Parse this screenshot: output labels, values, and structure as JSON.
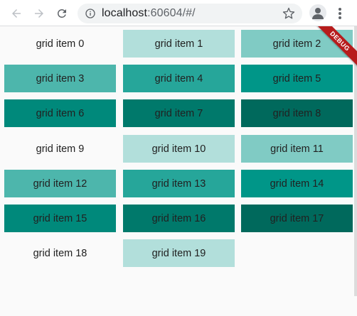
{
  "browser": {
    "url_host": "localhost",
    "url_rest": ":60604/#/",
    "icons": {
      "back": "arrow-left-icon",
      "forward": "arrow-right-icon",
      "reload": "reload-icon",
      "info": "info-icon",
      "bookmark": "star-icon",
      "profile": "person-icon",
      "menu": "kebab-menu-icon"
    }
  },
  "debug_banner": {
    "label": "DEBUG",
    "color": "#b71c1c"
  },
  "grid": {
    "items": [
      {
        "label": "grid item 0",
        "color": "#fafafa"
      },
      {
        "label": "grid item 1",
        "color": "#b2dfdb"
      },
      {
        "label": "grid item 2",
        "color": "#80cbc4"
      },
      {
        "label": "grid item 3",
        "color": "#4db6ac"
      },
      {
        "label": "grid item 4",
        "color": "#26a69a"
      },
      {
        "label": "grid item 5",
        "color": "#009688"
      },
      {
        "label": "grid item 6",
        "color": "#00897b"
      },
      {
        "label": "grid item 7",
        "color": "#00796b"
      },
      {
        "label": "grid item 8",
        "color": "#00695c"
      },
      {
        "label": "grid item 9",
        "color": "#fafafa"
      },
      {
        "label": "grid item 10",
        "color": "#b2dfdb"
      },
      {
        "label": "grid item 11",
        "color": "#80cbc4"
      },
      {
        "label": "grid item 12",
        "color": "#4db6ac"
      },
      {
        "label": "grid item 13",
        "color": "#26a69a"
      },
      {
        "label": "grid item 14",
        "color": "#009688"
      },
      {
        "label": "grid item 15",
        "color": "#00897b"
      },
      {
        "label": "grid item 16",
        "color": "#00796b"
      },
      {
        "label": "grid item 17",
        "color": "#00695c"
      },
      {
        "label": "grid item 18",
        "color": "#fafafa"
      },
      {
        "label": "grid item 19",
        "color": "#b2dfdb"
      }
    ]
  }
}
